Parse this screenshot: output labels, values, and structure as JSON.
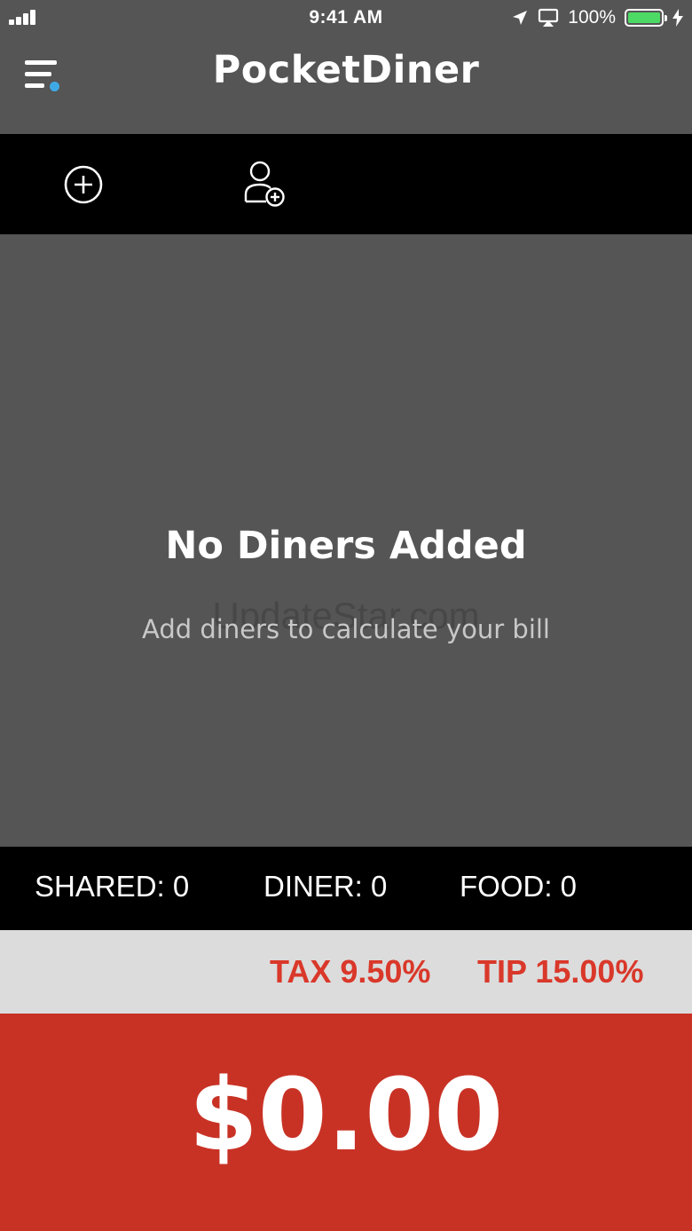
{
  "status_bar": {
    "time": "9:41 AM",
    "battery_percent": "100%",
    "battery_level": 1.0,
    "icons": [
      "signal-icon",
      "location-arrow-icon",
      "airplay-icon",
      "battery-icon",
      "charging-bolt-icon"
    ]
  },
  "nav": {
    "title": "PocketDiner",
    "menu_icon": "menu-icon",
    "accent_color": "#3fa9e6"
  },
  "toolbar": {
    "add_item_icon": "plus-circle-icon",
    "add_diner_icon": "add-person-icon"
  },
  "empty_state": {
    "title": "No Diners Added",
    "subtitle": "Add diners to calculate your bill",
    "watermark": "UpdateStar.com"
  },
  "counts": {
    "shared": "SHARED: 0",
    "diner": "DINER: 0",
    "food": "FOOD: 0"
  },
  "rates": {
    "tax": "TAX 9.50%",
    "tip": "TIP 15.00%",
    "color": "#d9382a"
  },
  "total": {
    "amount": "$0.00",
    "background": "#c83225"
  }
}
